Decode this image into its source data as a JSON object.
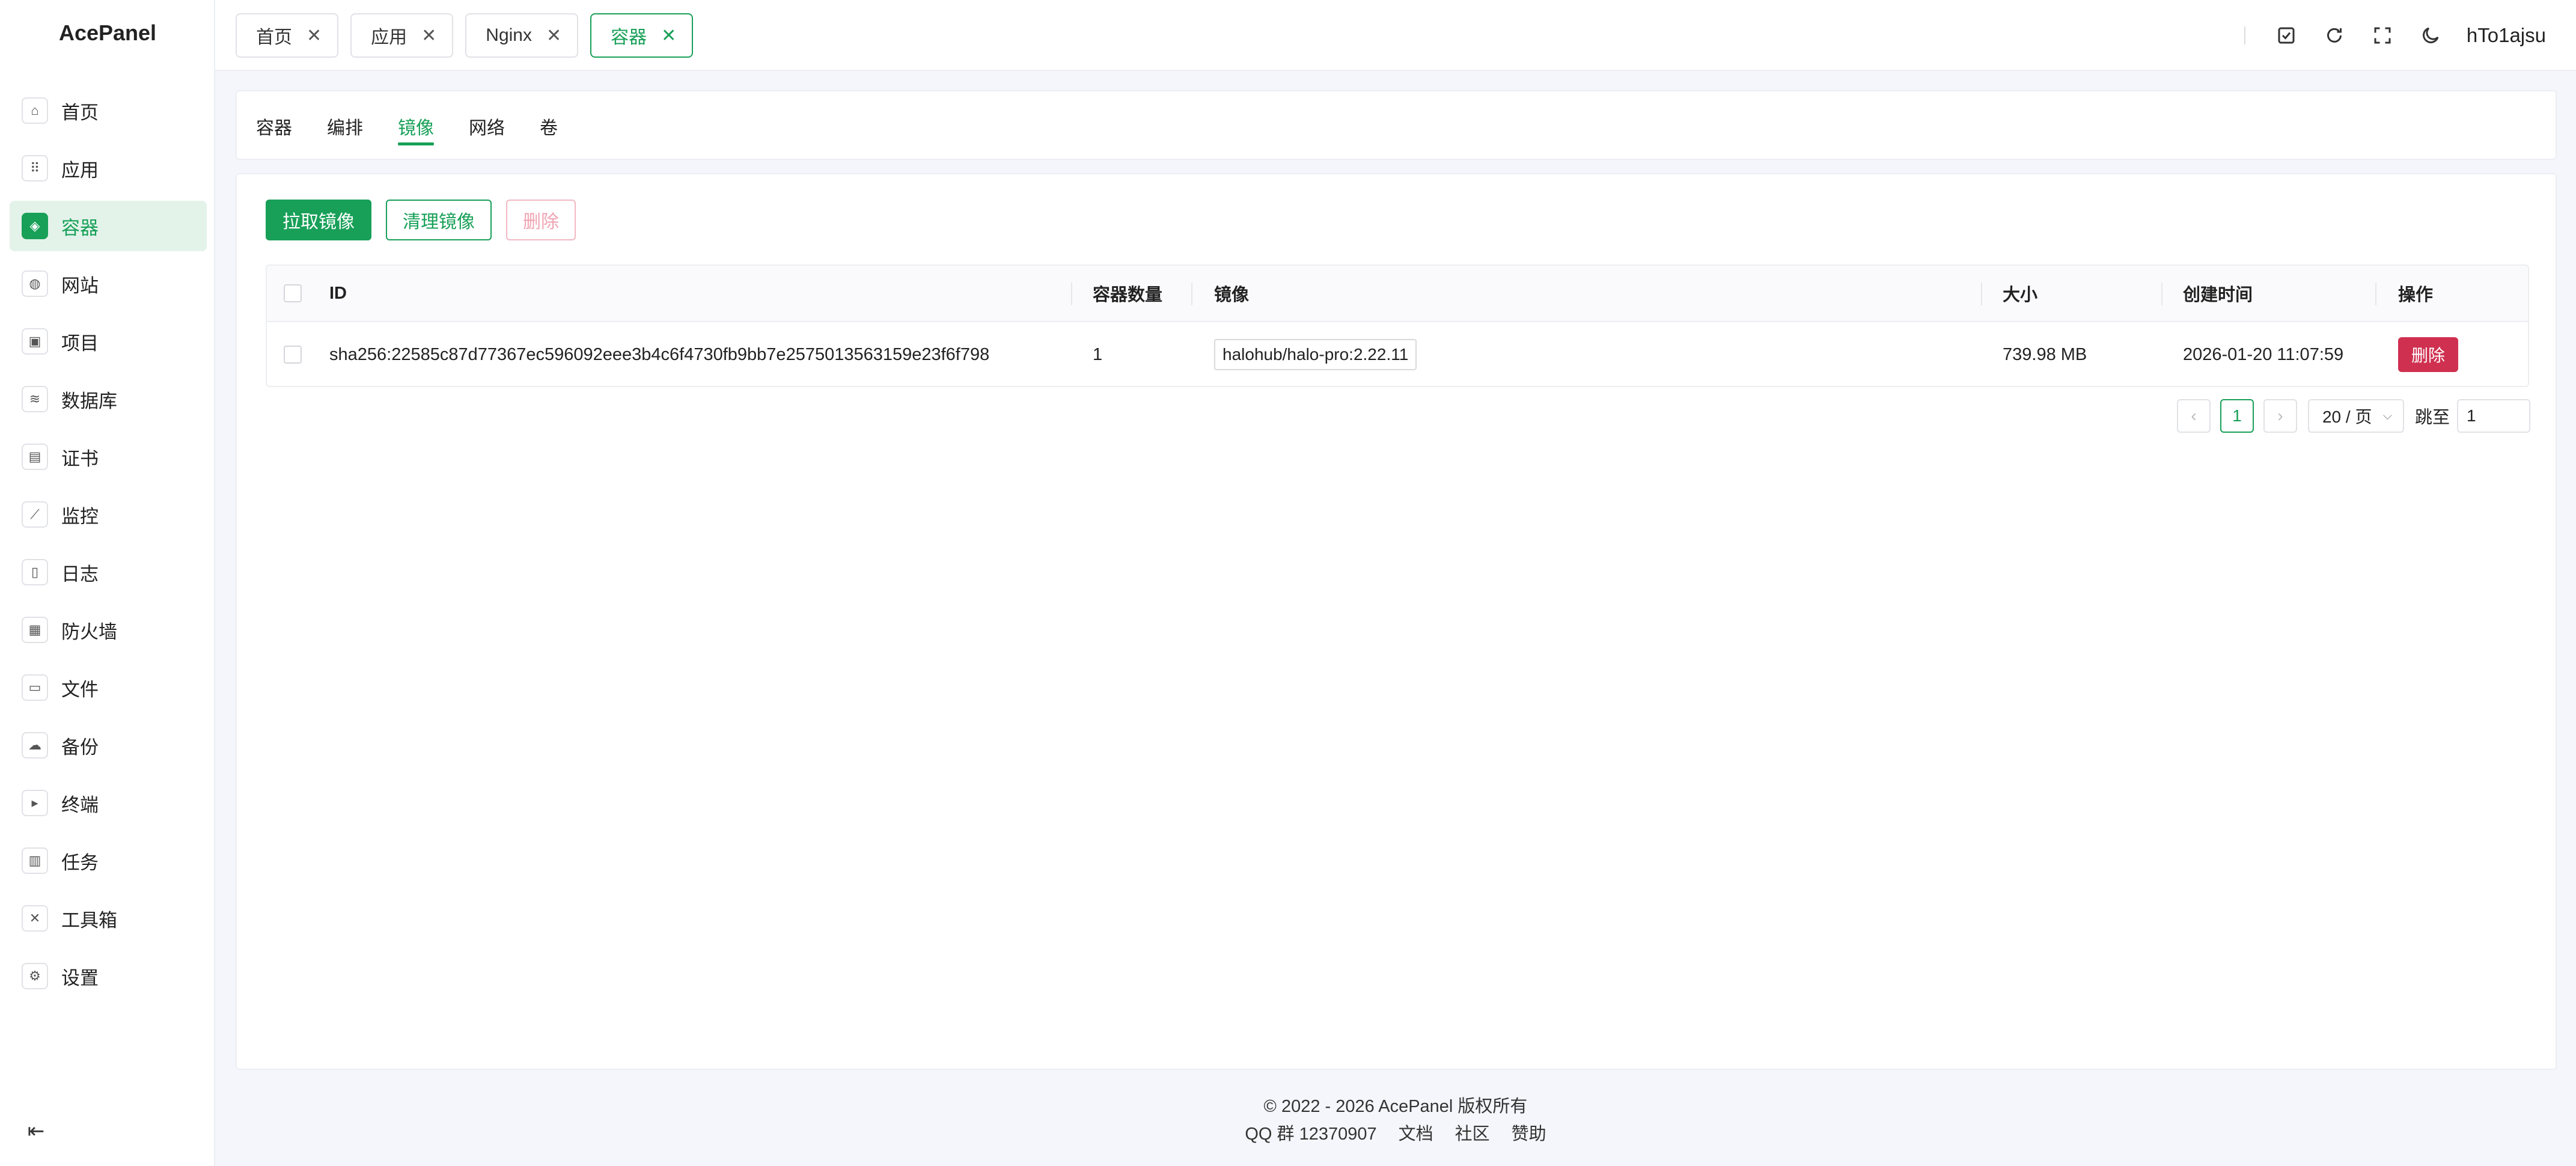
{
  "app": {
    "brand": "AcePanel",
    "username": "hTo1ajsu"
  },
  "sidebar": {
    "items": [
      {
        "label": "首页",
        "icon": "home-icon",
        "glyph": "⌂",
        "active": false
      },
      {
        "label": "应用",
        "icon": "apps-grid-icon",
        "glyph": "⠿",
        "active": false
      },
      {
        "label": "容器",
        "icon": "container-icon",
        "glyph": "◈",
        "active": true
      },
      {
        "label": "网站",
        "icon": "globe-icon",
        "glyph": "◍",
        "active": false
      },
      {
        "label": "项目",
        "icon": "project-icon",
        "glyph": "▣",
        "active": false
      },
      {
        "label": "数据库",
        "icon": "database-icon",
        "glyph": "≋",
        "active": false
      },
      {
        "label": "证书",
        "icon": "certificate-icon",
        "glyph": "▤",
        "active": false
      },
      {
        "label": "监控",
        "icon": "chart-line-icon",
        "glyph": "⟋",
        "active": false
      },
      {
        "label": "日志",
        "icon": "log-file-icon",
        "glyph": "▯",
        "active": false
      },
      {
        "label": "防火墙",
        "icon": "firewall-icon",
        "glyph": "▦",
        "active": false
      },
      {
        "label": "文件",
        "icon": "folder-icon",
        "glyph": "▭",
        "active": false
      },
      {
        "label": "备份",
        "icon": "cloud-backup-icon",
        "glyph": "☁",
        "active": false
      },
      {
        "label": "终端",
        "icon": "terminal-icon",
        "glyph": "▸",
        "active": false
      },
      {
        "label": "任务",
        "icon": "task-icon",
        "glyph": "▥",
        "active": false
      },
      {
        "label": "工具箱",
        "icon": "toolbox-icon",
        "glyph": "✕",
        "active": false
      },
      {
        "label": "设置",
        "icon": "gear-icon",
        "glyph": "⚙",
        "active": false
      }
    ]
  },
  "tabs": [
    {
      "label": "首页",
      "active": false
    },
    {
      "label": "应用",
      "active": false
    },
    {
      "label": "Nginx",
      "active": false
    },
    {
      "label": "容器",
      "active": true
    }
  ],
  "subtabs": [
    {
      "label": "容器",
      "active": false
    },
    {
      "label": "编排",
      "active": false
    },
    {
      "label": "镜像",
      "active": true
    },
    {
      "label": "网络",
      "active": false
    },
    {
      "label": "卷",
      "active": false
    }
  ],
  "toolbar": {
    "pull_label": "拉取镜像",
    "prune_label": "清理镜像",
    "delete_label": "删除"
  },
  "table": {
    "headers": {
      "id": "ID",
      "containers": "容器数量",
      "image": "镜像",
      "size": "大小",
      "created": "创建时间",
      "actions": "操作"
    },
    "rows": [
      {
        "id": "sha256:22585c87d77367ec596092eee3b4c6f4730fb9bb7e2575013563159e23f6f798",
        "containers": "1",
        "image": "halohub/halo-pro:2.22.11",
        "size": "739.98 MB",
        "created": "2026-01-20 11:07:59",
        "delete_label": "删除"
      }
    ]
  },
  "pagination": {
    "current_page": "1",
    "page_size": "20 / 页",
    "jump_label": "跳至",
    "jump_value": "1"
  },
  "footer": {
    "copyright": "© 2022 - 2026 AcePanel 版权所有",
    "qq": "QQ 群 12370907",
    "links": [
      "文档",
      "社区",
      "赞助"
    ]
  },
  "colors": {
    "primary": "#18a058",
    "danger": "#d03050",
    "background": "#f5f6fb"
  }
}
